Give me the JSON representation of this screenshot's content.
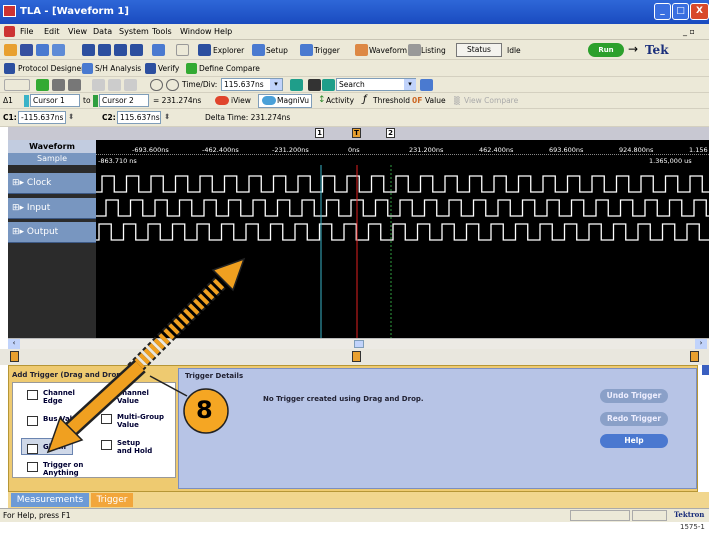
{
  "window": {
    "title": "TLA - [Waveform 1]",
    "minimize": "_",
    "maximize": "□",
    "close": "X"
  },
  "menu": [
    "File",
    "Edit",
    "View",
    "Data",
    "System",
    "Tools",
    "Window",
    "Help"
  ],
  "menu_right": "_ ▫",
  "toolbar1": {
    "explorer": "Explorer",
    "setup": "Setup",
    "trigger": "Trigger",
    "waveform": "Waveform",
    "listing": "Listing",
    "status_button": "Status",
    "status_value": "Idle",
    "run": "Run",
    "brand": "Tek"
  },
  "toolbar2": {
    "protocol": "Protocol Designer",
    "sh_analysis": "S/H Analysis",
    "verify": "Verify",
    "compare": "Define Compare"
  },
  "toolbar3": {
    "timediv_label": "Time/Div:",
    "timediv_value": "115.637ns",
    "search": "Search"
  },
  "toolbar4": {
    "delta_sym": "Δ1",
    "cursor1": "Cursor 1",
    "to": "to",
    "cursor2": "Cursor 2",
    "delta_value": "= 231.274ns",
    "view": "iView",
    "magnivu": "MagniVu",
    "activity": "Activity",
    "threshold": "Threshold",
    "value": "Value",
    "view_compare": "View Compare"
  },
  "cursorbar": {
    "c1_label": "C1:",
    "c1_value": "-115.637ns",
    "c2_label": "C2:",
    "c2_value": "115.637ns",
    "delta": "Delta Time: 231.274ns"
  },
  "waveform": {
    "header": "Waveform",
    "sample": "Sample",
    "sample_left": "-863.710 ns",
    "sample_right": "1.365,000 us",
    "ticks": [
      "-693.600ns",
      "-462.400ns",
      "-231.200ns",
      "0ns",
      "231.200ns",
      "462.400ns",
      "693.600ns",
      "924.800ns",
      "1.156"
    ],
    "signals": [
      "Clock",
      "Input",
      "Output"
    ],
    "markers": [
      "1",
      "T",
      "2"
    ]
  },
  "bottom": {
    "add_trigger_title": "Add Trigger (Drag and Drop)",
    "items": [
      "Channel Edge",
      "Channel Value",
      "Bus Value",
      "Multi-Group Value",
      "Glitch",
      "Setup and Hold",
      "Trigger on Anything"
    ],
    "details_title": "Trigger Details",
    "details_msg": "No Trigger created using Drag and Drop.",
    "undo": "Undo Trigger",
    "redo": "Redo Trigger",
    "help": "Help"
  },
  "tabs": [
    "Measurements",
    "Trigger"
  ],
  "status": {
    "text": "For Help, press F1",
    "brand": "Tektron"
  },
  "callout": "8",
  "figure_id": "1575-1",
  "colors": {
    "title": "#1f53c8",
    "panel": "#eeca70",
    "signal": "#7896c0",
    "cursor1": "#3ab3c8",
    "trigger": "#e02020",
    "cursor2": "#2f9e3f",
    "arrow": "#e89a1a"
  }
}
